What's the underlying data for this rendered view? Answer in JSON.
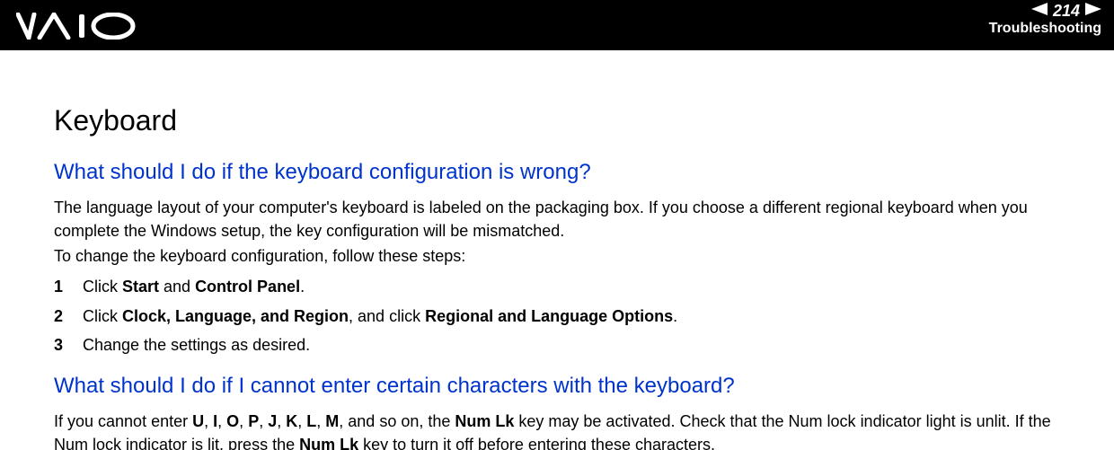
{
  "header": {
    "page_number": "214",
    "section": "Troubleshooting"
  },
  "content": {
    "title": "Keyboard",
    "q1": {
      "heading": "What should I do if the keyboard configuration is wrong?",
      "para1": "The language layout of your computer's keyboard is labeled on the packaging box. If you choose a different regional keyboard when you complete the Windows setup, the key configuration will be mismatched.",
      "para2": "To change the keyboard configuration, follow these steps:",
      "steps": [
        {
          "pre": "Click ",
          "b1": "Start",
          "mid": " and ",
          "b2": "Control Panel",
          "post": "."
        },
        {
          "pre": "Click ",
          "b1": "Clock, Language, and Region",
          "mid": ", and click ",
          "b2": "Regional and Language Options",
          "post": "."
        },
        {
          "pre": "Change the settings as desired.",
          "b1": "",
          "mid": "",
          "b2": "",
          "post": ""
        }
      ]
    },
    "q2": {
      "heading": "What should I do if I cannot enter certain characters with the keyboard?",
      "para_a": "If you cannot enter ",
      "keys": [
        "U",
        "I",
        "O",
        "P",
        "J",
        "K",
        "L",
        "M"
      ],
      "para_b": ", and so on, the ",
      "bold1": "Num Lk",
      "para_c": " key may be activated. Check that the Num lock indicator light is unlit. If the Num lock indicator is lit, press the ",
      "bold2": "Num Lk",
      "para_d": " key to turn it off before entering these characters."
    }
  }
}
